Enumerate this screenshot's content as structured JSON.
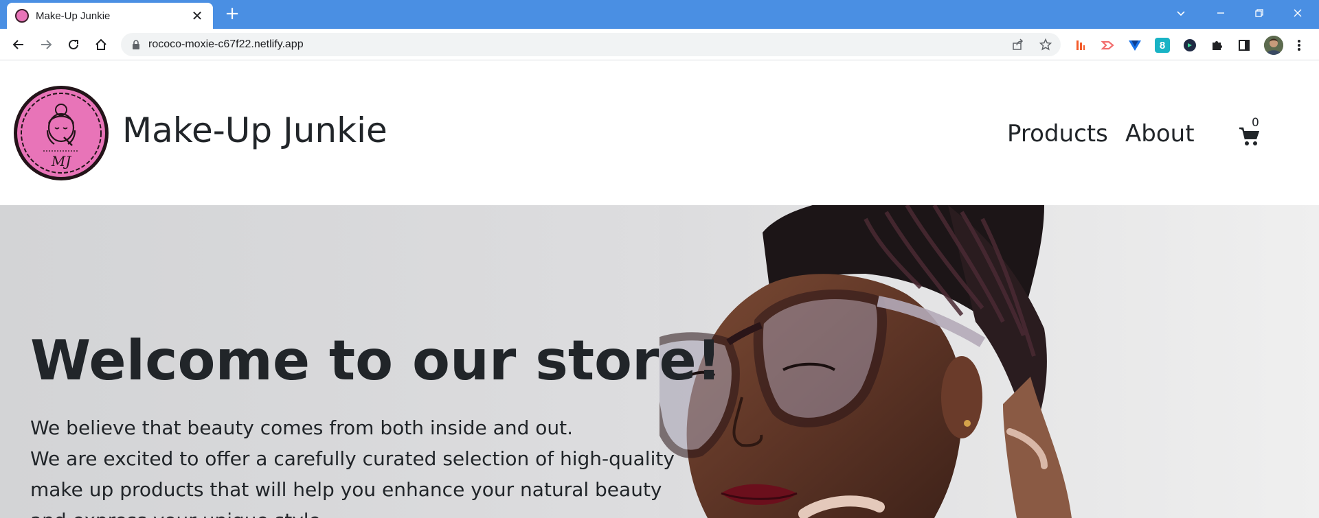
{
  "browser": {
    "tab_title": "Make-Up Junkie",
    "url": "rococo-moxie-c67f22.netlify.app",
    "new_tab_symbol": "+",
    "close_symbol": "✕",
    "extensions": [
      {
        "name": "bar-extension-icon",
        "color": "#f35b2a"
      },
      {
        "name": "arrow-extension-icon",
        "color": "#f26d6d"
      },
      {
        "name": "v-extension-icon",
        "color": "#1a73e8"
      },
      {
        "name": "eight-extension-icon",
        "color": "#19b3c5",
        "label": "8"
      },
      {
        "name": "circle-extension-icon",
        "color": "#1f2a44"
      },
      {
        "name": "puzzle-extension-icon",
        "color": "#202124"
      },
      {
        "name": "sidepanel-icon",
        "color": "#202124"
      }
    ]
  },
  "site": {
    "brand": "Make-Up Junkie",
    "logo_initials": "MJ",
    "nav": {
      "products": "Products",
      "about": "About"
    },
    "cart_count": "0",
    "accent_color": "#e874b8"
  },
  "hero": {
    "title": "Welcome to our store!",
    "line1": "We believe that beauty comes from both inside and out.",
    "line2": "We are excited to offer a carefully curated selection of high-quality make up products that will help you enhance your natural beauty and express your unique style."
  }
}
